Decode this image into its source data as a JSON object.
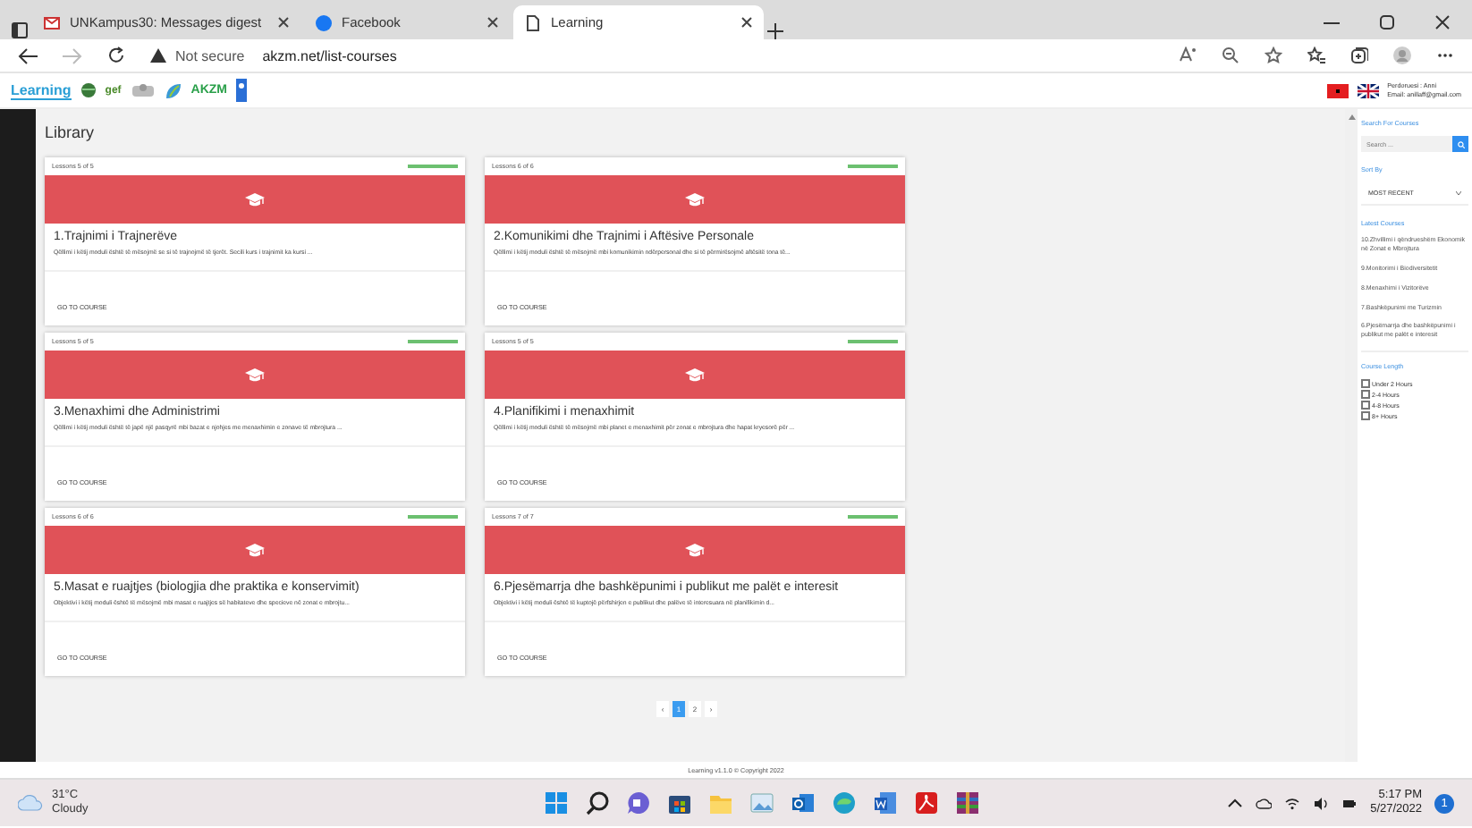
{
  "browser": {
    "tabs": [
      {
        "title": "UNKampus30: Messages digest",
        "selected": false
      },
      {
        "title": "Facebook",
        "selected": false
      },
      {
        "title": "Learning",
        "selected": true
      }
    ],
    "security": "Not secure",
    "url": "akzm.net/list-courses"
  },
  "header": {
    "logo": "Learning",
    "partner_logos": [
      "gef",
      "AKZM"
    ],
    "user": "Perdoruesi : Anni",
    "email": "Email: anillaff@gmail.com"
  },
  "page_title": "Library",
  "courses": [
    {
      "lessons": "Lessons 5 of 5",
      "level": 1,
      "title": "1.Trajnimi i Trajnerëve",
      "description": "Qëllimi i këtij moduli është të mësojmë se si të trajnojmë të tjerët. Secili kurs i trajnimit ka kursi ...",
      "action": "GO TO COURSE"
    },
    {
      "lessons": "Lessons 6 of 6",
      "level": 1,
      "title": "2.Komunikimi dhe Trajnimi i Aftësive Personale",
      "description": "Qëllimi i këtij moduli është të mësojmë mbi komunikimin ndërpersonal dhe si të përmirësojmë aftësitë tona të...",
      "action": "GO TO COURSE"
    },
    {
      "lessons": "Lessons 5 of 5",
      "level": 1,
      "title": "3.Menaxhimi dhe Administrimi",
      "description": "Qëllimi i këtij moduli është të japë një pasqyrë mbi bazat e njohjes me menaxhimin e zonave të mbrojtura ...",
      "action": "GO TO COURSE"
    },
    {
      "lessons": "Lessons 5 of 5",
      "level": 1,
      "title": "4.Planifikimi i menaxhimit",
      "description": "Qëllimi i këtij moduli është të mësojmë mbi planet e menaxhimit për zonat e mbrojtura dhe hapat kryesorë për ...",
      "action": "GO TO COURSE"
    },
    {
      "lessons": "Lessons 6 of 6",
      "level": 1,
      "title": "5.Masat e ruajtjes (biologjia dhe praktika e konservimit)",
      "description": "Objektivi i këtij moduli është të mësojmë mbi masat e ruajtjes së habitateve dhe specieve në zonat e mbrojtu...",
      "action": "GO TO COURSE"
    },
    {
      "lessons": "Lessons 7 of 7",
      "level": 1,
      "title": "6.Pjesëmarrja dhe bashkëpunimi i publikut me palët e interesit",
      "description": "Objektivi i këtij moduli është të kuptojë përfshirjen e publikut dhe palëve të interesuara në planifikimin d...",
      "action": "GO TO COURSE"
    }
  ],
  "pagination": [
    {
      "label": "‹",
      "selected": false
    },
    {
      "label": "1",
      "selected": true
    },
    {
      "label": "2",
      "selected": false
    },
    {
      "label": "›",
      "selected": false
    }
  ],
  "sidebar": {
    "search_heading": "Search For Courses",
    "search_placeholder": "Search ...",
    "sort_heading": "Sort By",
    "sort_value": "MOST RECENT",
    "latest_heading": "Latest Courses",
    "latest_courses": [
      "10.Zhvillimi i qëndrueshëm Ekonomik në Zonat e Mbrojtura",
      "9.Monitorimi i Biodiversitetit",
      "8.Menaxhimi i Vizitorëve",
      "7.Bashkëpunimi me Turizmin",
      "6.Pjesëmarrja dhe bashkëpunimi i publikut me palët e interesit"
    ],
    "length_heading": "Course Length",
    "lengths": [
      {
        "label": "Under 2 Hours",
        "checked": false
      },
      {
        "label": "2-4 Hours",
        "checked": false
      },
      {
        "label": "4-8 Hours",
        "checked": false
      },
      {
        "label": "8+ Hours",
        "checked": false
      }
    ]
  },
  "footer": "Learning v1.1.0 © Copyright 2022",
  "taskbar": {
    "temperature": "31°C",
    "weather": "Cloudy",
    "time": "5:17 PM",
    "date": "5/27/2022",
    "notifications": "1"
  }
}
